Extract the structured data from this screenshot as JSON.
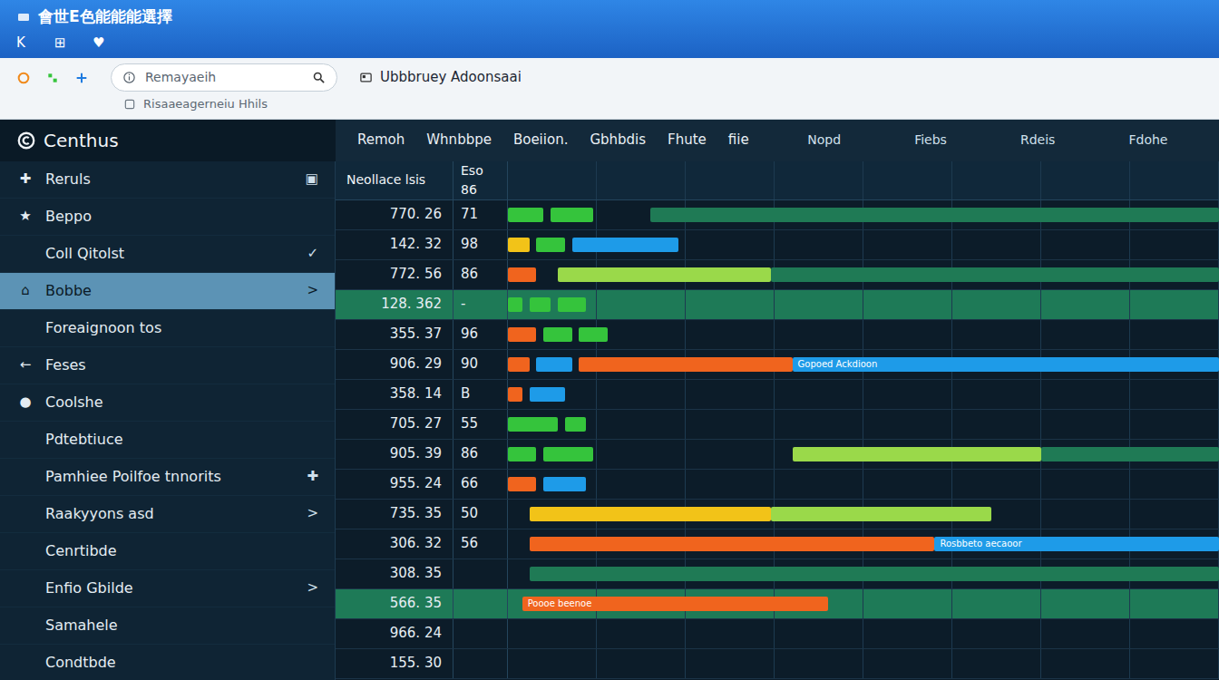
{
  "window": {
    "title": "會世E色能能能選擇",
    "toolbar": [
      "K",
      "⊞",
      "♥"
    ]
  },
  "search": {
    "placeholder": "Remayaeih"
  },
  "tab": {
    "label": "Ubbbruey Adoonsaai"
  },
  "address": {
    "text": "Risaaeagerneiu Hhils"
  },
  "app": {
    "logo": "Centhus"
  },
  "menu": [
    "Remoh",
    "Whnbbpe",
    "Boeiion.",
    "Gbhbdis",
    "Fhute",
    "fiie"
  ],
  "sidebar": {
    "items": [
      {
        "icon": "✚",
        "label": "Reruls",
        "trail": "▣",
        "selected": false
      },
      {
        "icon": "★",
        "label": "Beppo",
        "selected": false
      },
      {
        "label": "Coll Qitolst",
        "trail": "✓",
        "selected": false
      },
      {
        "icon": "⌂",
        "label": "Bobbe",
        "trail": ">",
        "selected": true
      },
      {
        "label": "Foreaignoon tos",
        "selected": false
      },
      {
        "icon": "←",
        "label": "Feses",
        "selected": false
      },
      {
        "icon": "●",
        "label": "Coolshe",
        "selected": false
      },
      {
        "label": "Pdtebtiuce",
        "selected": false
      },
      {
        "label": "Pamhiee Poilfoe tnnorits",
        "trail": "✚",
        "selected": false
      },
      {
        "label": "Raakyyons asd",
        "trail": ">",
        "selected": false
      },
      {
        "label": "Cenrtibde",
        "selected": false
      },
      {
        "label": "Enfio Gbilde",
        "trail": ">",
        "selected": false
      },
      {
        "label": "Samahele",
        "selected": false
      },
      {
        "label": "Condtbde",
        "selected": false
      }
    ]
  },
  "chart": {
    "axis": {
      "min": 0,
      "max": 100
    },
    "headers": [
      "Nopd",
      "Fiebs",
      "Rdeis",
      "Fdohe"
    ],
    "columns": [
      "Neollace lsis",
      "Eso 86"
    ],
    "rows": [
      {
        "value": "770. 26",
        "code": "71",
        "selected": false,
        "bars": [
          {
            "values": [
              0,
              5
            ],
            "color": "#35c43c"
          },
          {
            "values": [
              6,
              12
            ],
            "color": "#35c43c"
          },
          {
            "values": [
              20,
              100
            ],
            "color": "#1f7a55"
          }
        ]
      },
      {
        "value": "142. 32",
        "code": "98",
        "selected": false,
        "bars": [
          {
            "values": [
              0,
              3
            ],
            "color": "#f2c318"
          },
          {
            "values": [
              4,
              8
            ],
            "color": "#35c43c"
          },
          {
            "values": [
              9,
              24
            ],
            "color": "#1e9be8"
          }
        ]
      },
      {
        "value": "772. 56",
        "code": "86",
        "selected": false,
        "bars": [
          {
            "values": [
              0,
              4
            ],
            "color": "#f0641e"
          },
          {
            "values": [
              7,
              37
            ],
            "color": "#9ad94a"
          },
          {
            "values": [
              37,
              100
            ],
            "color": "#1f7a55"
          }
        ]
      },
      {
        "value": "128. 362",
        "code": "-",
        "selected": true,
        "bars": [
          {
            "values": [
              0,
              2
            ],
            "color": "#35c43c"
          },
          {
            "values": [
              3,
              6
            ],
            "color": "#35c43c"
          },
          {
            "values": [
              7,
              11
            ],
            "color": "#35c43c"
          }
        ]
      },
      {
        "value": "355. 37",
        "code": "96",
        "selected": false,
        "bars": [
          {
            "values": [
              0,
              4
            ],
            "color": "#f0641e"
          },
          {
            "values": [
              5,
              9
            ],
            "color": "#35c43c"
          },
          {
            "values": [
              10,
              14
            ],
            "color": "#35c43c"
          }
        ]
      },
      {
        "value": "906. 29",
        "code": "90",
        "selected": false,
        "bars": [
          {
            "values": [
              0,
              3
            ],
            "color": "#f0641e"
          },
          {
            "values": [
              4,
              9
            ],
            "color": "#1e9be8"
          },
          {
            "values": [
              10,
              40
            ],
            "color": "#f0641e"
          },
          {
            "values": [
              40,
              100
            ],
            "color": "#1e9be8",
            "label": "Gopoed Ackdioon"
          }
        ]
      },
      {
        "value": "358. 14",
        "code": "B",
        "selected": false,
        "bars": [
          {
            "values": [
              0,
              2
            ],
            "color": "#f0641e"
          },
          {
            "values": [
              3,
              8
            ],
            "color": "#1e9be8"
          }
        ]
      },
      {
        "value": "705. 27",
        "code": "55",
        "selected": false,
        "bars": [
          {
            "values": [
              0,
              7
            ],
            "color": "#35c43c"
          },
          {
            "values": [
              8,
              11
            ],
            "color": "#35c43c"
          }
        ]
      },
      {
        "value": "905. 39",
        "code": "86",
        "selected": false,
        "bars": [
          {
            "values": [
              0,
              4
            ],
            "color": "#35c43c"
          },
          {
            "values": [
              5,
              12
            ],
            "color": "#35c43c"
          },
          {
            "values": [
              40,
              75
            ],
            "color": "#9ad94a"
          },
          {
            "values": [
              75,
              100
            ],
            "color": "#1f7a55"
          }
        ]
      },
      {
        "value": "955. 24",
        "code": "66",
        "selected": false,
        "bars": [
          {
            "values": [
              0,
              4
            ],
            "color": "#f0641e"
          },
          {
            "values": [
              5,
              11
            ],
            "color": "#1e9be8"
          }
        ]
      },
      {
        "value": "735. 35",
        "code": "50",
        "selected": false,
        "bars": [
          {
            "values": [
              3,
              37
            ],
            "color": "#f2c318"
          },
          {
            "values": [
              37,
              68
            ],
            "color": "#9ad94a"
          }
        ]
      },
      {
        "value": "306. 32",
        "code": "56",
        "selected": false,
        "bars": [
          {
            "values": [
              3,
              60
            ],
            "color": "#f0641e"
          },
          {
            "values": [
              60,
              100
            ],
            "color": "#1e9be8",
            "label": "Rosbbeto aecaoor"
          }
        ]
      },
      {
        "value": "308. 35",
        "selected": false,
        "bars": [
          {
            "values": [
              3,
              100
            ],
            "color": "#1f7a55"
          }
        ]
      },
      {
        "value": "566. 35",
        "selected": true,
        "bars": [
          {
            "values": [
              2,
              45
            ],
            "color": "#f0641e",
            "label": "Poooe beenoe"
          }
        ]
      },
      {
        "value": "966. 24",
        "selected": false,
        "bars": []
      },
      {
        "value": "155. 30",
        "selected": false,
        "bars": []
      }
    ]
  }
}
